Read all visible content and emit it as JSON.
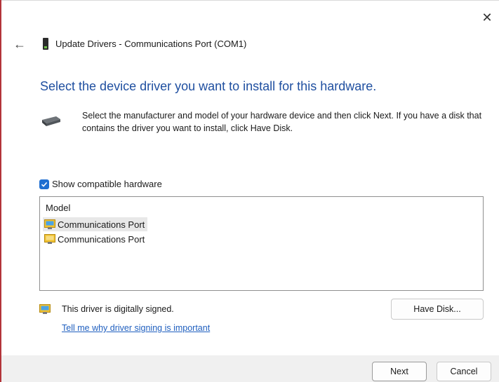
{
  "window": {
    "title": "Update Drivers - Communications Port (COM1)",
    "close_glyph": "✕",
    "back_glyph": "←"
  },
  "heading": "Select the device driver you want to install for this hardware.",
  "instructions": "Select the manufacturer and model of your hardware device and then click Next. If you have a disk that contains the driver you want to install, click Have Disk.",
  "compatible": {
    "label": "Show compatible hardware",
    "checked": true
  },
  "model_list": {
    "header": "Model",
    "items": [
      {
        "label": "Communications Port",
        "selected": true
      },
      {
        "label": "Communications Port",
        "selected": false
      }
    ]
  },
  "signing": {
    "status_text": "This driver is digitally signed.",
    "link_text": "Tell me why driver signing is important"
  },
  "buttons": {
    "have_disk": "Have Disk...",
    "next": "Next",
    "cancel": "Cancel"
  },
  "colors": {
    "accent": "#1f6fd1",
    "heading": "#1f4fa0",
    "link": "#1f5fbf",
    "window_border": "#b3343a"
  }
}
